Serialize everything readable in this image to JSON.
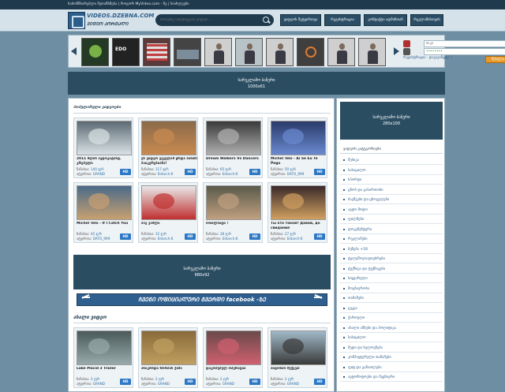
{
  "topbar": {
    "text": "საბონნსარებლი შეთანხმება  |  როგორ MyVideo.com - ზე  |  სიახლეები"
  },
  "header": {
    "logo_top": "VIDEOS.DZEBNA.COM",
    "logo_bottom": "ᲕᲘᲓᲔᲝ ᲞᲝᲠᲢᲐᲚᲘ",
    "search": {
      "placeholder": "მოძებნე სასურველი ვიდეო ..."
    },
    "nav": [
      "ვიდეოს შეტვირთვა",
      "რეგისტრაცია",
      "კონტაქტი ადმინთან",
      "რეკლამისთვის"
    ]
  },
  "slider": {
    "thumb_labels": [
      "",
      "EDO",
      "",
      "",
      "",
      "",
      "",
      "",
      "",
      ""
    ]
  },
  "login": {
    "username_placeholder": "ნიკი",
    "password_value": "••••••••",
    "links": "რეგისტრაცია · დაგავიწყდა ?",
    "enter_label": "შესვლა"
  },
  "banners": {
    "top": {
      "title": "სარეკლამო ბანერი",
      "size": "1000x61"
    },
    "side": {
      "title": "სარეკლამო ბანერი",
      "size": "280x100"
    },
    "middle": {
      "title": "სარეკლამო ბანერი",
      "size": "680x92"
    }
  },
  "sections": {
    "popular_title": "ᲞᲝᲞᲣᲚᲐᲠᲣᲚᲘ ᲕᲘᲓᲔᲝᲔᲑᲘ",
    "new_title": "ᲐᲮᲐᲚᲘ ᲕᲘᲓᲔᲝ",
    "facebook": "ᲩᲕᲔᲜᲘ ᲝᲤᲘᲪᲘᲐᲚᲣᲠᲘ ᲒᲕᲔᲠᲓᲘ facebook -ᲖᲔ"
  },
  "video_meta_labels": {
    "views": "ნანახია:",
    "added": "ატვირთა:",
    "hd": "HD"
  },
  "popular_videos": [
    {
      "title": "2011 წლის ავტოკატასტ. კრებული",
      "views": "140 ჯერ",
      "user": "GRAND"
    },
    {
      "title": "ეს ვიდეო ვეველამ ყრდა ბანიჩ/ ბაიკერებიანა!",
      "views": "117 ჯერ",
      "user": "Eldarch:K"
    },
    {
      "title": "Dream Walkers Vs Dancers",
      "views": "65 ჯერ",
      "user": "Eldarch:K"
    },
    {
      "title": "Michel Telo - Ai Se Eu Te Pego",
      "views": "50 ჯერ",
      "user": "DATO_999"
    },
    {
      "title": "Michel Telo - If I Catch You",
      "views": "45 ჯერ",
      "user": "DATO_999"
    },
    {
      "title": "ბავ ვაშლი",
      "views": "32 ჯერ",
      "user": "Eldarch:K"
    },
    {
      "title": "ბოთლბიტი !",
      "views": "28 ჯერ",
      "user": "Eldarch:K"
    },
    {
      "title": "Ты кто такой? Давай, до свидания",
      "views": "27 ჯერ",
      "user": "Eldarch:K"
    }
  ],
  "new_videos": [
    {
      "title": "Lake Placid 3 Trailer",
      "views": "2 ჯერ",
      "user": "GRAND"
    },
    {
      "title": "ანაკონდა ზორბას ქამა",
      "views": "2 ჯერ",
      "user": "GRAND"
    },
    {
      "title": "დაკოძებულ ოპერაცია",
      "views": "2 ჯერ",
      "user": "GRAND"
    },
    {
      "title": "პიტონის შუქვეთ",
      "views": "2 ჯერ",
      "user": "GRAND"
    }
  ],
  "categories": {
    "title": "ვიდეოს კატეგორიები",
    "items": [
      "მუსიკა",
      "სასაცილო",
      "სპორტი",
      "ცნობ და გასართობი",
      "ბავშვები და ცხოველები",
      "ავტო მოტო",
      "ფილმები",
      "დოკუმენტური",
      "რეკლამები",
      "ბუნება +18",
      "ტელეშოუ/აფთებრები",
      "ტექნიკა და ტექნიკები",
      "სიყვარული",
      "მოგზაურობა",
      "თამაშები",
      "ცეკვა",
      "ქართული",
      "ახალი ამბები და პოლიტიკა",
      "სასაცილო",
      "მედი და ხელოვნება",
      "კომპიუტერული თამაშები",
      "ფიტ და განათლება",
      "ავტომოტოები და მეცნიერი"
    ]
  },
  "colors": {
    "bg": "#6e8ea3",
    "panel": "#2a4d62",
    "accent": "#2d78c5",
    "button_orange": "#e89a2c"
  }
}
